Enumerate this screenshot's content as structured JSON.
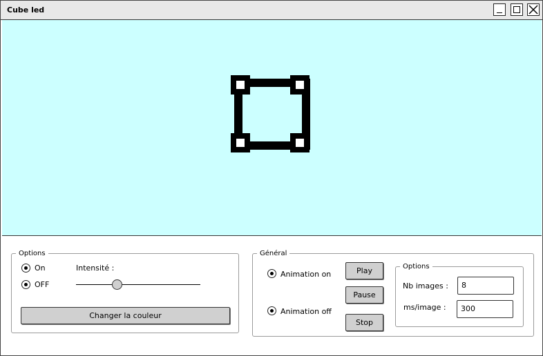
{
  "window": {
    "title": "Cube led",
    "controls": {
      "minimize_icon": "minimize-icon",
      "maximize_icon": "maximize-icon",
      "close_icon": "close-icon"
    }
  },
  "canvas": {
    "background": "#ccffff",
    "icon": "cube-square-icon"
  },
  "options_group": {
    "legend": "Options",
    "radio_on_label": "On",
    "radio_off_label": "OFF",
    "intensity_label": "Intensité :",
    "intensity_value": 0.33,
    "color_button_label": "Changer la couleur"
  },
  "general_group": {
    "legend": "Général",
    "animation_on_label": "Animation on",
    "animation_off_label": "Animation off",
    "play_label": "Play",
    "pause_label": "Pause",
    "stop_label": "Stop",
    "sub_options": {
      "legend": "Options",
      "nb_images_label": "Nb images :",
      "nb_images_value": "8",
      "ms_image_label": "ms/image :",
      "ms_image_value": "300"
    }
  }
}
